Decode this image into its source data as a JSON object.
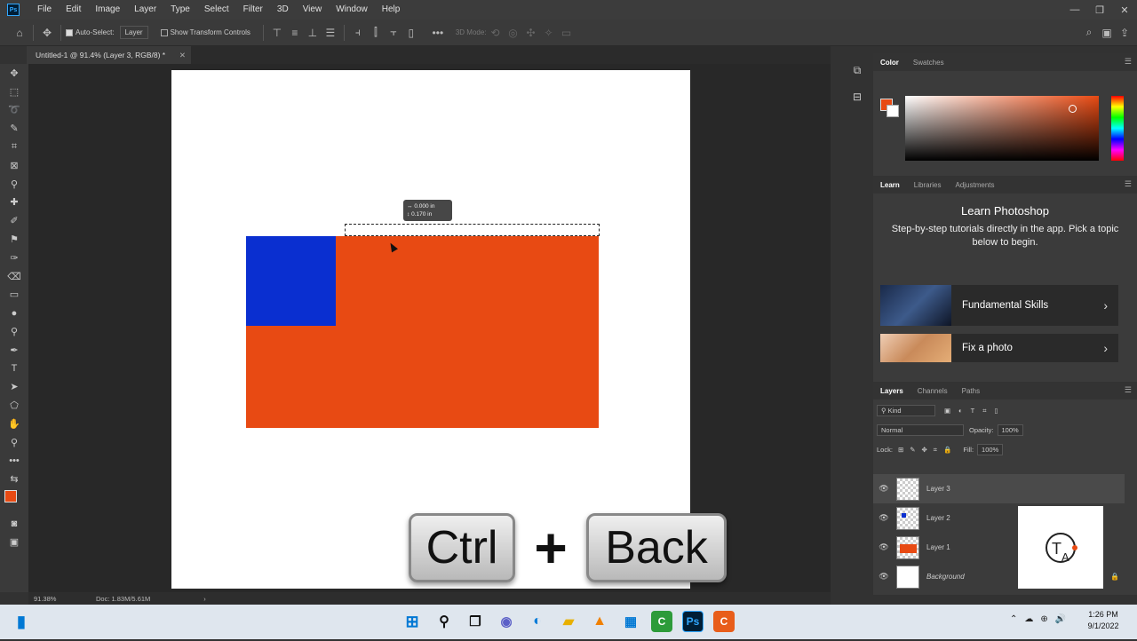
{
  "menubar": {
    "logo": "Ps",
    "items": [
      "File",
      "Edit",
      "Image",
      "Layer",
      "Type",
      "Select",
      "Filter",
      "3D",
      "View",
      "Window",
      "Help"
    ]
  },
  "optionsbar": {
    "auto_select_label": "Auto-Select:",
    "auto_select_value": "Layer",
    "transform_label": "Show Transform Controls",
    "mode_3d_label": "3D Mode:"
  },
  "document": {
    "tab_title": "Untitled-1 @ 91.4% (Layer 3, RGB/8) *",
    "tooltip_line1": "0.000 in",
    "tooltip_line2": "0.170 in"
  },
  "statusbar": {
    "zoom": "91.38%",
    "doc_size": "Doc: 1.83M/5.61M"
  },
  "overlay": {
    "key1": "Ctrl",
    "plus": "+",
    "key2": "Back"
  },
  "panels": {
    "color_tabs": [
      "Color",
      "Swatches"
    ],
    "learn_tabs": [
      "Learn",
      "Libraries",
      "Adjustments"
    ],
    "learn_title": "Learn Photoshop",
    "learn_subtitle": "Step-by-step tutorials directly in the app. Pick a topic below to begin.",
    "learn_cards": [
      "Fundamental Skills",
      "Fix a photo"
    ],
    "layers_tabs": [
      "Layers",
      "Channels",
      "Paths"
    ],
    "kind_label": "Kind",
    "blend_mode": "Normal",
    "opacity_label": "Opacity:",
    "opacity_value": "100%",
    "lock_label": "Lock:",
    "fill_label": "Fill:",
    "fill_value": "100%",
    "layers": [
      "Layer 3",
      "Layer 2",
      "Layer 1",
      "Background"
    ]
  },
  "colors": {
    "foreground": "#e84a13",
    "blue_square": "#0a2fd0"
  },
  "taskbar": {
    "time": "1:26 PM",
    "date": "9/1/2022"
  }
}
